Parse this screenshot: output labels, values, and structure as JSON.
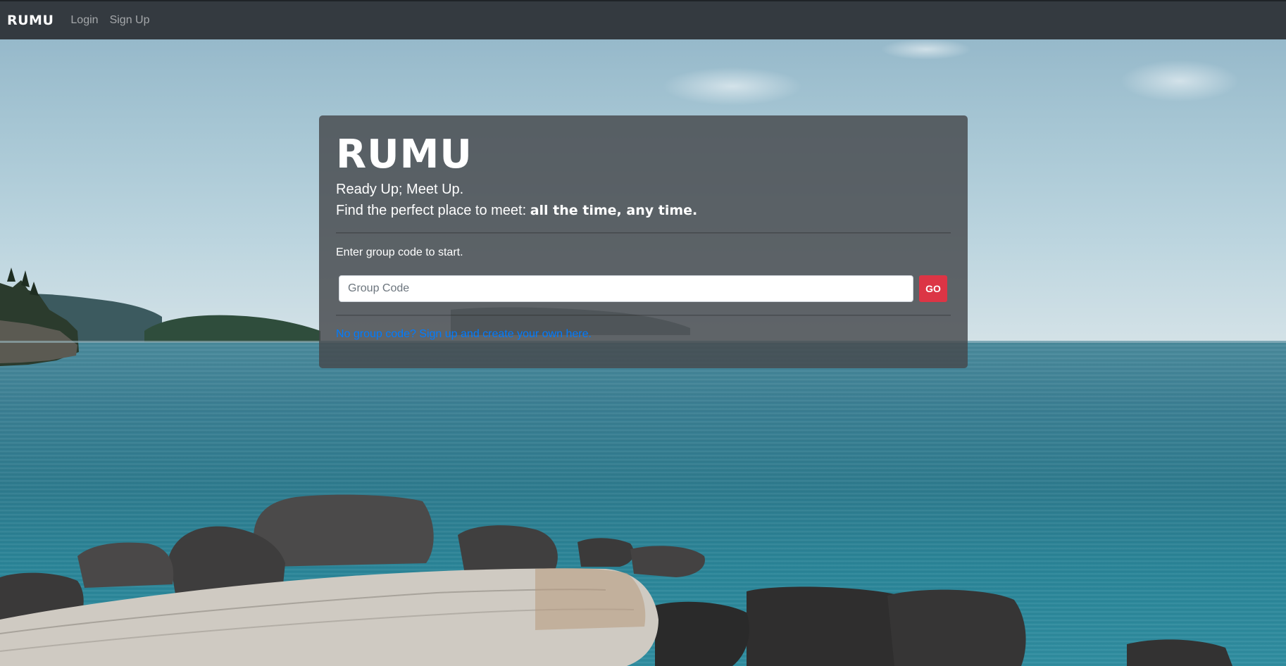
{
  "navbar": {
    "brand": "RUMU",
    "links": [
      {
        "label": "Login"
      },
      {
        "label": "Sign Up"
      }
    ]
  },
  "hero": {
    "title": "RUMU",
    "tagline": "Ready Up; Meet Up.",
    "subline_prefix": "Find the perfect place to meet: ",
    "subline_emphasis": "all the time, any time.",
    "instruction": "Enter group code to start.",
    "input": {
      "placeholder": "Group Code",
      "value": ""
    },
    "go_label": "GO",
    "signup_link": "No group code? Sign up and create your own here."
  },
  "colors": {
    "navbar_bg": "#343a40",
    "go_button": "#dc3545",
    "link": "#007bff"
  },
  "background": "coastal seascape photo with rocks and driftwood"
}
